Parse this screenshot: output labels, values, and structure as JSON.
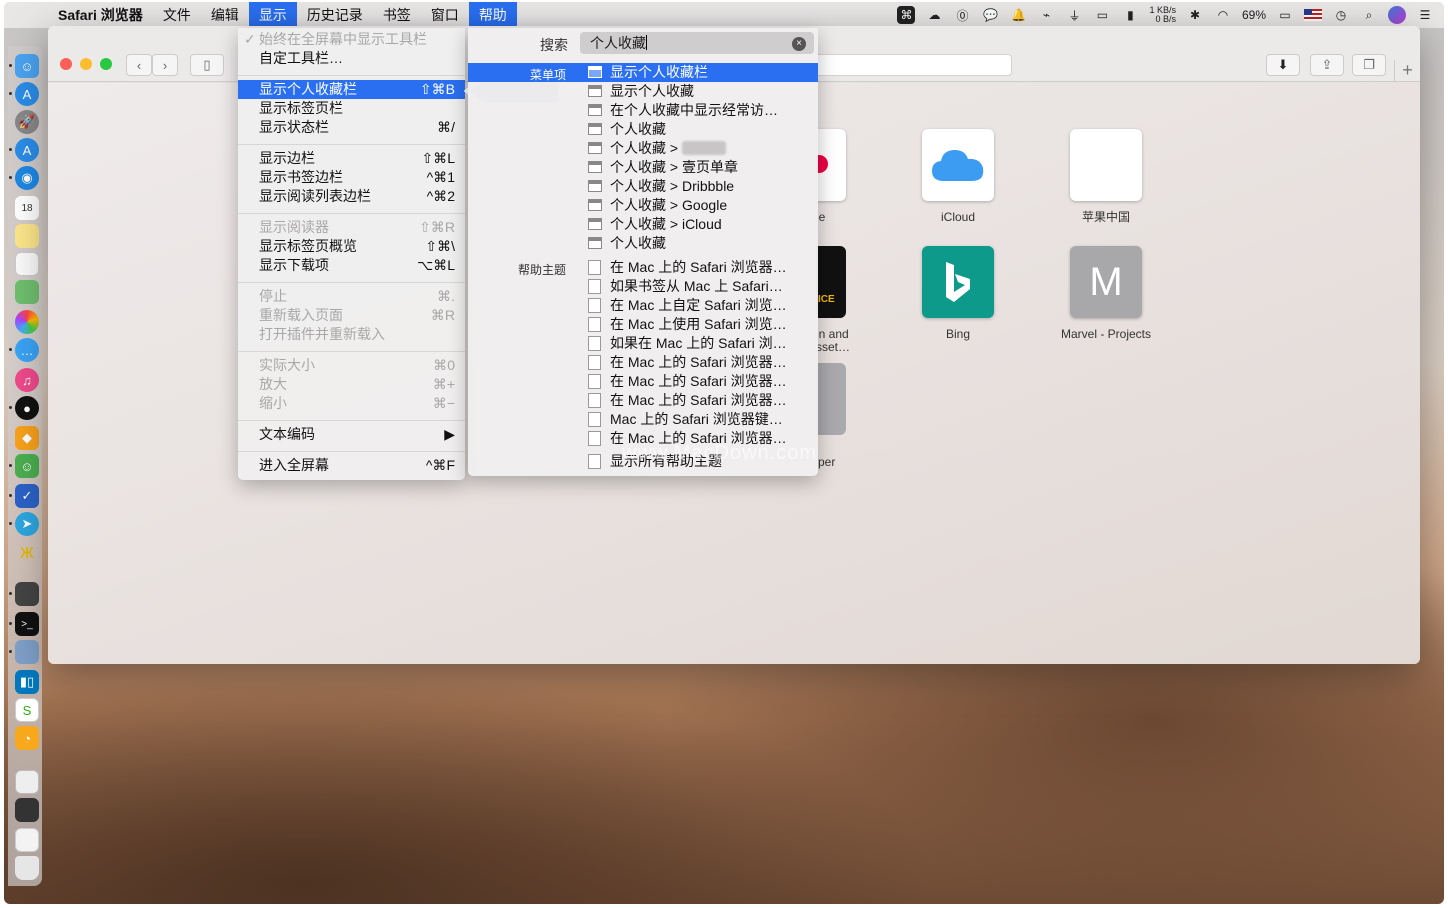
{
  "menubar": {
    "app_name": "Safari 浏览器",
    "menus": [
      "文件",
      "编辑",
      "显示",
      "历史记录",
      "书签",
      "窗口",
      "帮助"
    ],
    "active_menu": "显示",
    "help_menu": "帮助",
    "net_up": "1 KB/s",
    "net_down": "0 B/s",
    "battery": "69%"
  },
  "view_menu": {
    "items": [
      {
        "label": "始终在全屏幕中显示工具栏",
        "shortcut": "",
        "disabled": true,
        "checked": true
      },
      {
        "label": "自定工具栏…",
        "shortcut": ""
      },
      {
        "label": "显示个人收藏栏",
        "shortcut": "⇧⌘B",
        "highlighted": true
      },
      {
        "label": "显示标签页栏",
        "shortcut": ""
      },
      {
        "label": "显示状态栏",
        "shortcut": "⌘/"
      },
      {
        "label": "显示边栏",
        "shortcut": "⇧⌘L"
      },
      {
        "label": "显示书签边栏",
        "shortcut": "^⌘1"
      },
      {
        "label": "显示阅读列表边栏",
        "shortcut": "^⌘2"
      },
      {
        "label": "显示阅读器",
        "shortcut": "⇧⌘R",
        "disabled": true
      },
      {
        "label": "显示标签页概览",
        "shortcut": "⇧⌘\\"
      },
      {
        "label": "显示下载项",
        "shortcut": "⌥⌘L"
      },
      {
        "label": "停止",
        "shortcut": "⌘.",
        "disabled": true
      },
      {
        "label": "重新载入页面",
        "shortcut": "⌘R",
        "disabled": true
      },
      {
        "label": "打开插件并重新载入",
        "shortcut": "",
        "disabled": true
      },
      {
        "label": "实际大小",
        "shortcut": "⌘0",
        "disabled": true
      },
      {
        "label": "放大",
        "shortcut": "⌘+",
        "disabled": true
      },
      {
        "label": "缩小",
        "shortcut": "⌘−",
        "disabled": true
      },
      {
        "label": "文本编码",
        "shortcut": "▶"
      },
      {
        "label": "进入全屏幕",
        "shortcut": "^⌘F"
      }
    ]
  },
  "help_panel": {
    "search_label": "搜索",
    "search_value": "个人收藏",
    "clear_icon": "×",
    "section_menu": "菜单项",
    "section_help": "帮助主题",
    "menu_results": [
      "显示个人收藏栏",
      "显示个人收藏",
      "在个人收藏中显示经常访…",
      "个人收藏",
      "个人收藏 >",
      "个人收藏 > 壹页单章",
      "个人收藏 > Dribbble",
      "个人收藏 > Google",
      "个人收藏 > iCloud",
      "个人收藏"
    ],
    "help_results": [
      "在 Mac 上的 Safari 浏览器…",
      "如果书签从 Mac 上 Safari…",
      "在 Mac 上自定 Safari 浏览…",
      "在 Mac 上使用 Safari 浏览…",
      "如果在 Mac 上的 Safari 浏…",
      "在 Mac 上的 Safari 浏览器…",
      "在 Mac 上的 Safari 浏览器…",
      "在 Mac 上的 Safari 浏览器…",
      "Mac 上的 Safari 浏览器键…",
      "在 Mac 上的 Safari 浏览器…",
      "显示所有帮助主题"
    ]
  },
  "favorites": [
    {
      "name": "iCloud"
    },
    {
      "name": "苹果中国"
    },
    {
      "name": "Bing"
    },
    {
      "name": "Marvel - Projects"
    }
  ],
  "partial_labels": {
    "google": "le",
    "binance": "in and\nsset…",
    "binance_logo": "ICE",
    "other": "per"
  },
  "watermark": "www.MacDown.com",
  "icons": {
    "apple": "",
    "marvel_letter": "M"
  }
}
